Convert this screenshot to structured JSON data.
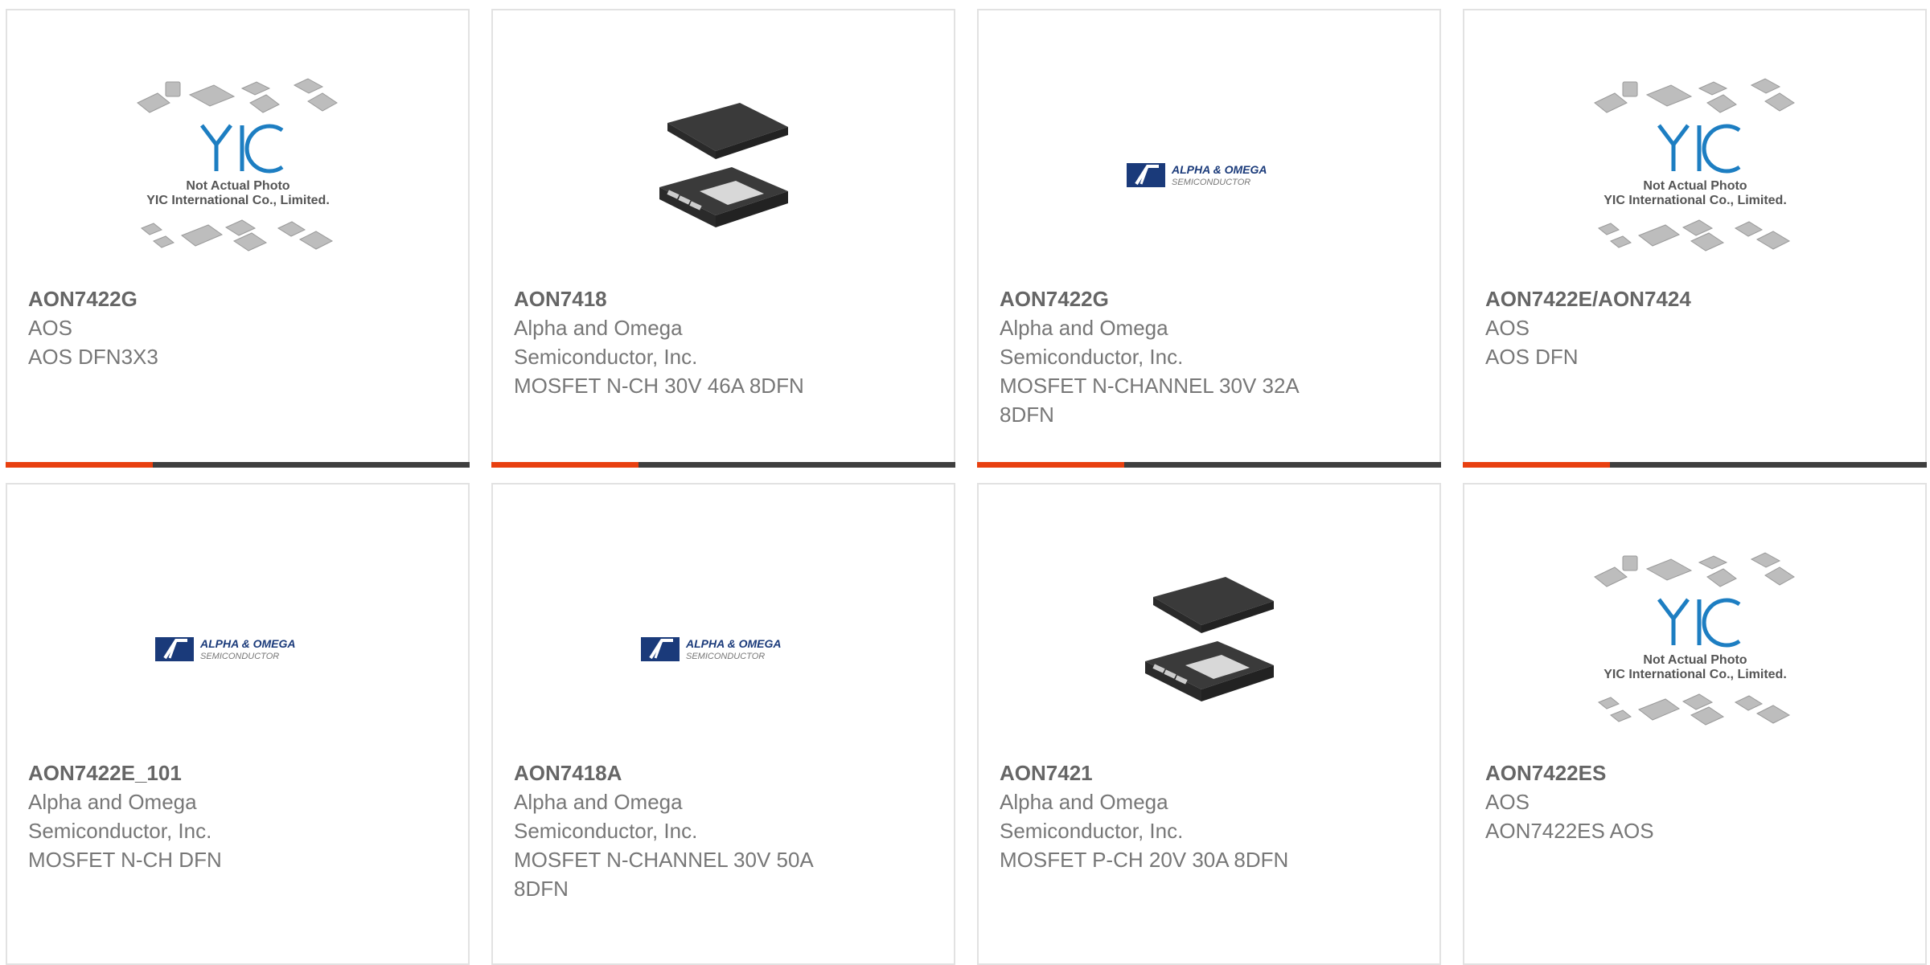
{
  "products": [
    {
      "part": "AON7422G",
      "lines": [
        "AOS",
        "AOS DFN3X3"
      ],
      "image": "yic-placeholder",
      "placeholder_text": [
        "Not Actual Photo",
        "YIC International Co., Limited."
      ]
    },
    {
      "part": "AON7418",
      "lines": [
        "Alpha and Omega",
        "Semiconductor, Inc.",
        "MOSFET N-CH 30V 46A 8DFN"
      ],
      "image": "dfn-chip"
    },
    {
      "part": "AON7422G",
      "lines": [
        "Alpha and Omega",
        "Semiconductor, Inc.",
        "MOSFET N-CHANNEL 30V 32A",
        "8DFN"
      ],
      "image": "alpha-omega-logo",
      "logo_text": [
        "ALPHA & OMEGA",
        "SEMICONDUCTOR"
      ]
    },
    {
      "part": "AON7422E/AON7424",
      "lines": [
        "AOS",
        "AOS DFN"
      ],
      "image": "yic-placeholder",
      "placeholder_text": [
        "Not Actual Photo",
        "YIC International Co., Limited."
      ]
    },
    {
      "part": "AON7422E_101",
      "lines": [
        "Alpha and Omega",
        "Semiconductor, Inc.",
        "MOSFET N-CH DFN"
      ],
      "image": "alpha-omega-logo",
      "logo_text": [
        "ALPHA & OMEGA",
        "SEMICONDUCTOR"
      ]
    },
    {
      "part": "AON7418A",
      "lines": [
        "Alpha and Omega",
        "Semiconductor, Inc.",
        "MOSFET N-CHANNEL 30V 50A",
        "8DFN"
      ],
      "image": "alpha-omega-logo",
      "logo_text": [
        "ALPHA & OMEGA",
        "SEMICONDUCTOR"
      ]
    },
    {
      "part": "AON7421",
      "lines": [
        "Alpha and Omega",
        "Semiconductor, Inc.",
        "MOSFET P-CH 20V 30A 8DFN"
      ],
      "image": "dfn-chip"
    },
    {
      "part": "AON7422ES",
      "lines": [
        "AOS",
        "AON7422ES AOS"
      ],
      "image": "yic-placeholder",
      "placeholder_text": [
        "Not Actual Photo",
        "YIC International Co., Limited."
      ]
    }
  ],
  "colors": {
    "accent_bar": "#e84010",
    "dark_bar": "#3f3f3f",
    "yic_blue": "#1d7ec2"
  }
}
